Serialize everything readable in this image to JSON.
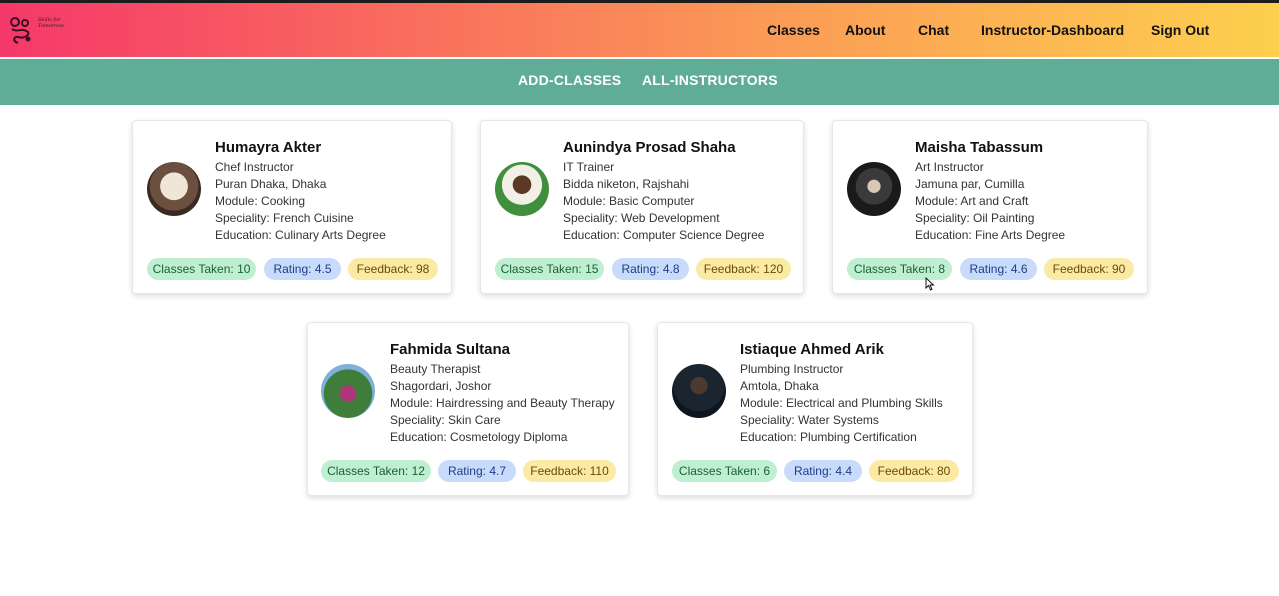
{
  "header": {
    "logo_text": "Skills for Tomorrow",
    "nav": [
      "Classes",
      "About",
      "Chat",
      "Instructor-Dashboard",
      "Sign Out"
    ]
  },
  "subnav": [
    "ADD-CLASSES",
    "ALL-INSTRUCTORS"
  ],
  "instructors": [
    {
      "name": "Humayra Akter",
      "title": "Chef Instructor",
      "location": "Puran Dhaka, Dhaka",
      "module": "Module: Cooking",
      "speciality": "Speciality: French Cuisine",
      "education": "Education: Culinary Arts Degree",
      "classes": "Classes Taken: 10",
      "rating": "Rating: 4.5",
      "feedback": "Feedback: 98"
    },
    {
      "name": "Aunindya Prosad Shaha",
      "title": "IT Trainer",
      "location": "Bidda niketon, Rajshahi",
      "module": "Module: Basic Computer",
      "speciality": "Speciality: Web Development",
      "education": "Education: Computer Science Degree",
      "classes": "Classes Taken: 15",
      "rating": "Rating: 4.8",
      "feedback": "Feedback: 120"
    },
    {
      "name": "Maisha Tabassum",
      "title": "Art Instructor",
      "location": "Jamuna par, Cumilla",
      "module": "Module: Art and Craft",
      "speciality": "Speciality: Oil Painting",
      "education": "Education: Fine Arts Degree",
      "classes": "Classes Taken: 8",
      "rating": "Rating: 4.6",
      "feedback": "Feedback: 90"
    },
    {
      "name": "Fahmida Sultana",
      "title": "Beauty Therapist",
      "location": "Shagordari, Joshor",
      "module": "Module: Hairdressing and Beauty Therapy",
      "speciality": "Speciality: Skin Care",
      "education": "Education: Cosmetology Diploma",
      "classes": "Classes Taken: 12",
      "rating": "Rating: 4.7",
      "feedback": "Feedback: 110"
    },
    {
      "name": "Istiaque Ahmed Arik",
      "title": "Plumbing Instructor",
      "location": "Amtola, Dhaka",
      "module": "Module: Electrical and Plumbing Skills",
      "speciality": "Speciality: Water Systems",
      "education": "Education: Plumbing Certification",
      "classes": "Classes Taken: 6",
      "rating": "Rating: 4.4",
      "feedback": "Feedback: 80"
    }
  ],
  "colors": {
    "header_gradient": [
      "#f5386a",
      "#fdd04e"
    ],
    "subbar": "#5fad97",
    "pill_green": "#bdefd0",
    "pill_blue": "#c8dbfa",
    "pill_yellow": "#fbeaa4"
  }
}
